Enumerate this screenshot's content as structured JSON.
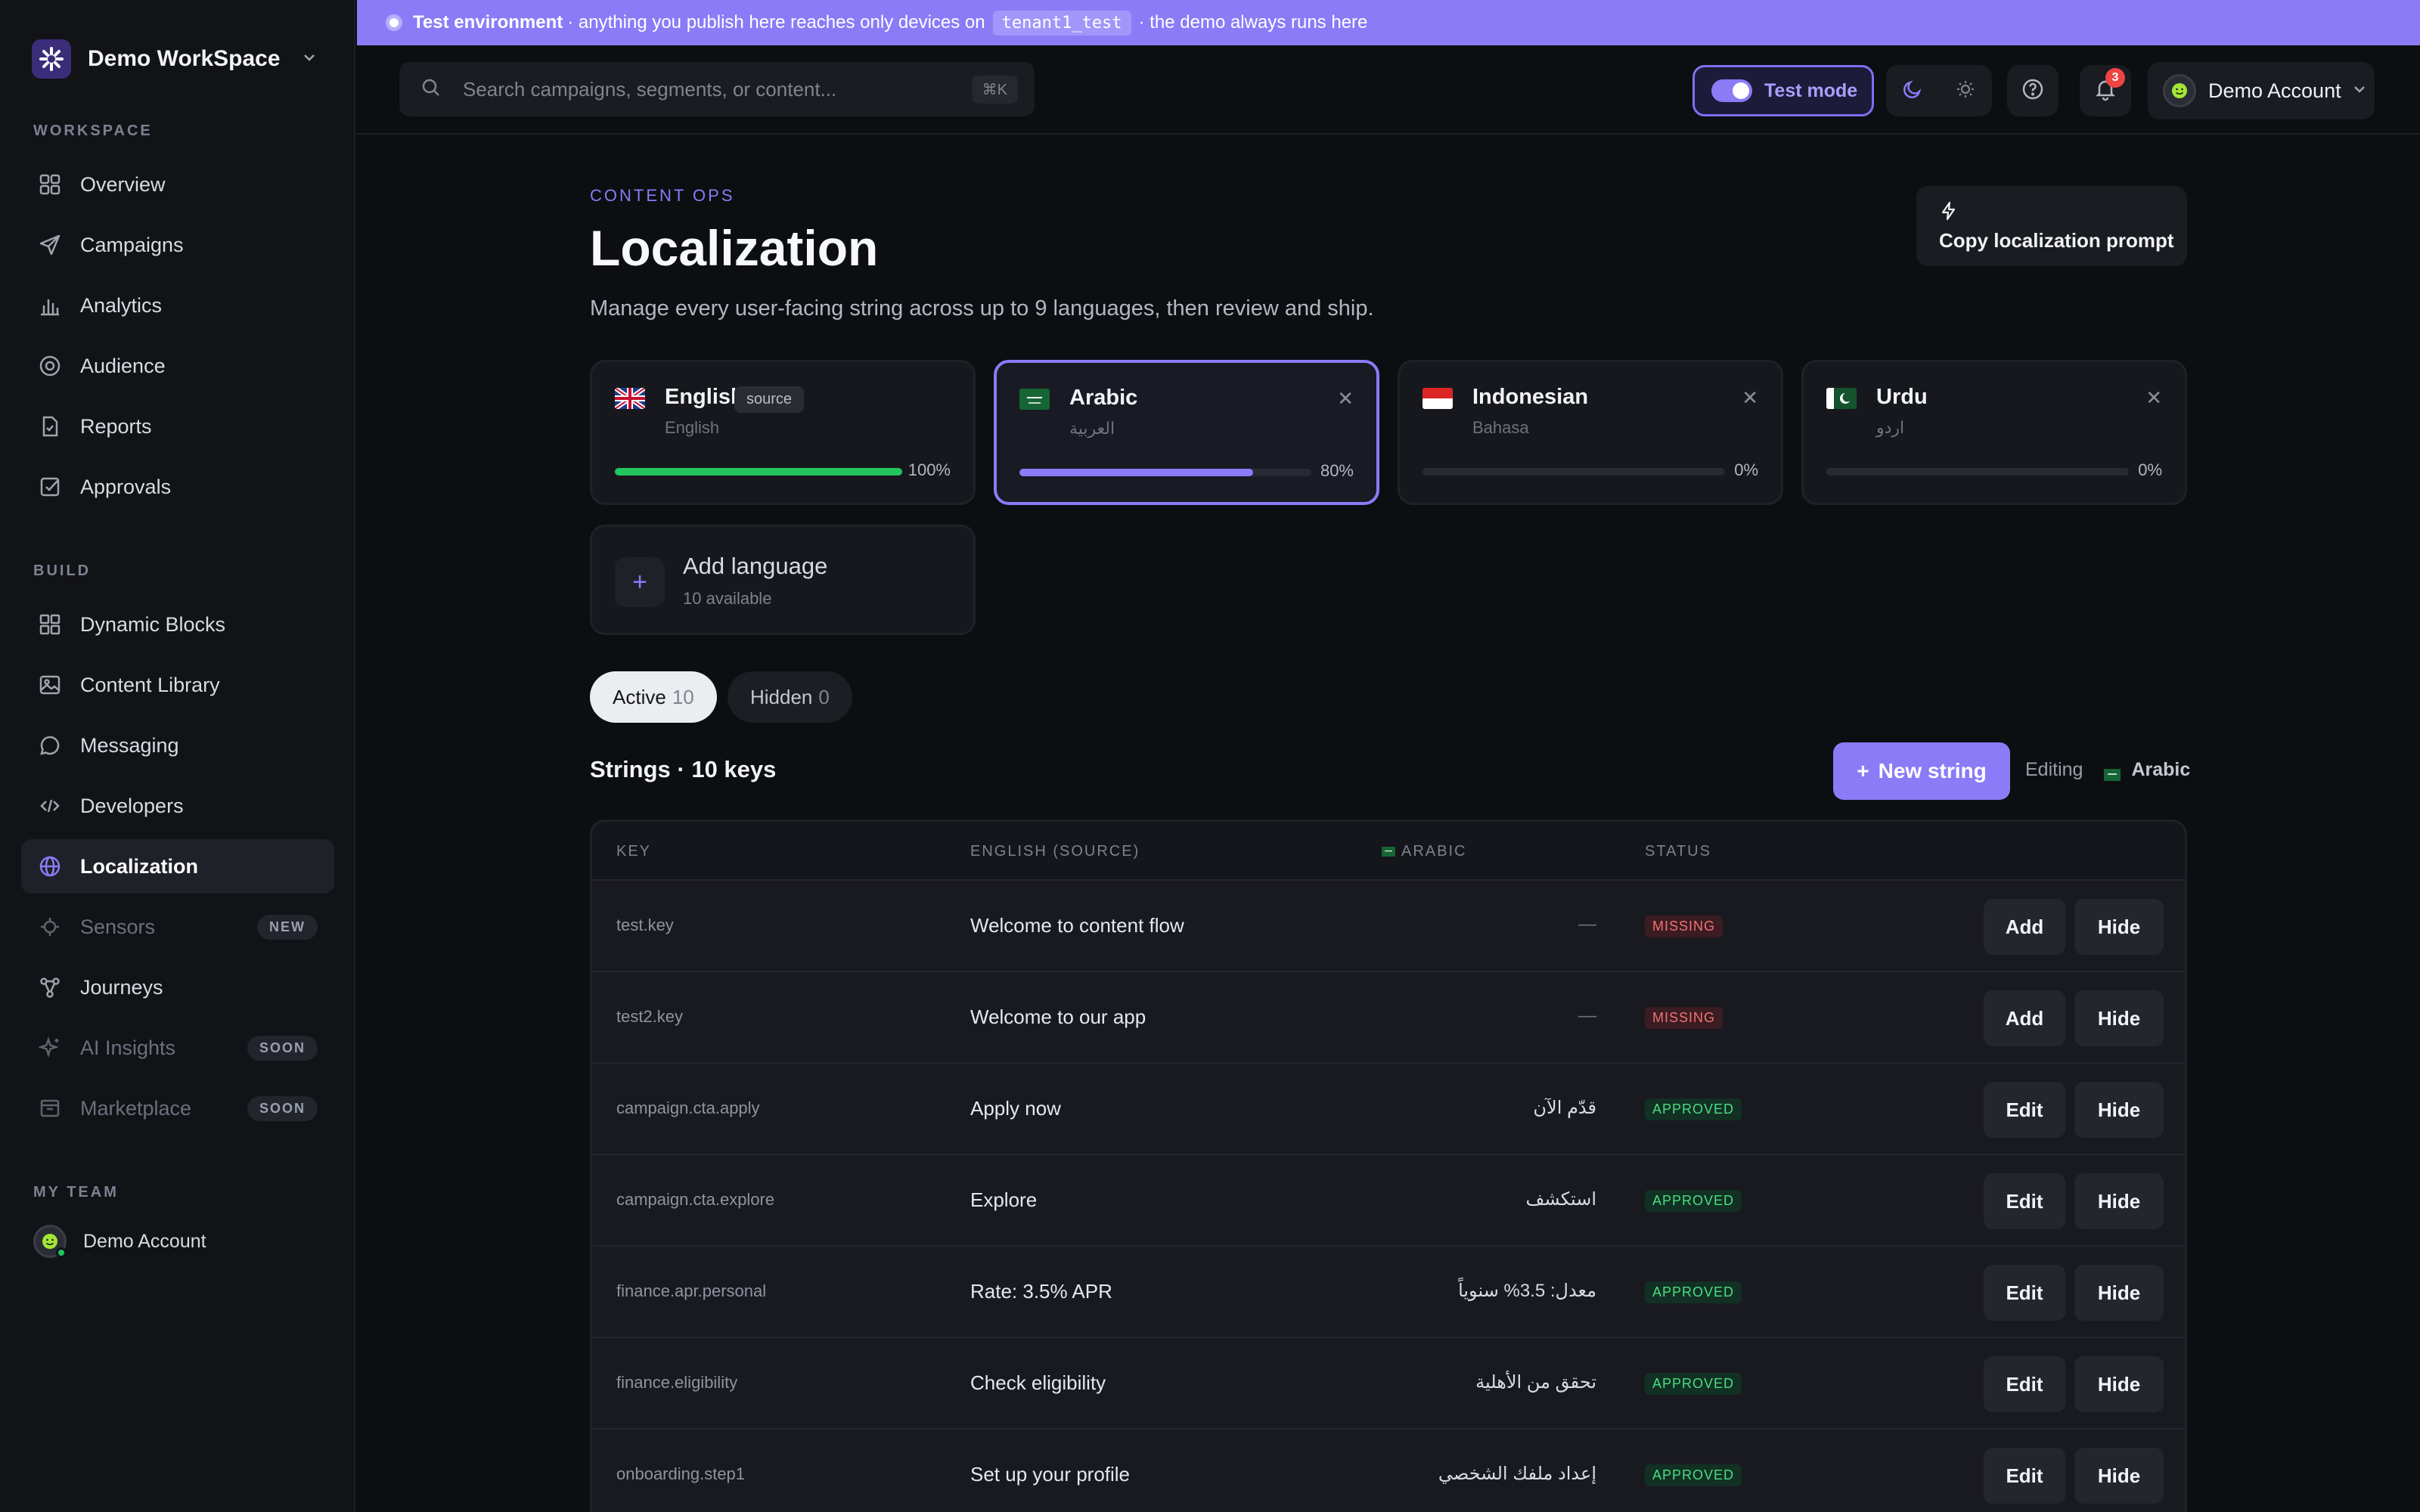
{
  "workspace": {
    "name": "Demo WorkSpace"
  },
  "sidebar": {
    "sections": [
      {
        "label": "WORKSPACE"
      },
      {
        "label": "BUILD"
      },
      {
        "label": "MY TEAM"
      }
    ],
    "items": [
      {
        "label": "Overview",
        "icon": "grid-icon"
      },
      {
        "label": "Campaigns",
        "icon": "send-icon"
      },
      {
        "label": "Analytics",
        "icon": "bar-chart-icon"
      },
      {
        "label": "Audience",
        "icon": "target-icon"
      },
      {
        "label": "Reports",
        "icon": "file-icon"
      },
      {
        "label": "Approvals",
        "icon": "check-square-icon"
      },
      {
        "label": "Dynamic Blocks",
        "icon": "blocks-icon"
      },
      {
        "label": "Content Library",
        "icon": "image-icon"
      },
      {
        "label": "Messaging",
        "icon": "chat-icon"
      },
      {
        "label": "Developers",
        "icon": "code-icon"
      },
      {
        "label": "Localization",
        "icon": "globe-icon",
        "active": true
      },
      {
        "label": "Sensors",
        "icon": "sensor-icon",
        "badge": "NEW"
      },
      {
        "label": "Journeys",
        "icon": "journey-icon"
      },
      {
        "label": "AI Insights",
        "icon": "sparkle-icon",
        "badge": "SOON"
      },
      {
        "label": "Marketplace",
        "icon": "store-icon",
        "badge": "SOON"
      }
    ],
    "team_member": "Demo Account"
  },
  "banner": {
    "title": "Test environment",
    "text_before": " · anything you publish here reaches only devices on",
    "tenant": "tenant1_test",
    "text_after": "· the demo always runs here"
  },
  "topbar": {
    "search_placeholder": "Search campaigns, segments, or content...",
    "shortcut": "⌘K",
    "test_mode_label": "Test mode",
    "notifications_count": "3",
    "account_name": "Demo Account"
  },
  "page": {
    "eyebrow": "CONTENT OPS",
    "title": "Localization",
    "subtitle": "Manage every user-facing string across up to 9 languages, then review and ship.",
    "copy_prompt_label": "Copy localization prompt"
  },
  "languages": [
    {
      "name": "English",
      "native": "English",
      "badge": "source",
      "progress_label": "100%",
      "progress": 1.0,
      "color": "#22c55e"
    },
    {
      "name": "Arabic",
      "native": "العربية",
      "progress_label": "80%",
      "progress": 0.8,
      "color": "#8b7bf7",
      "selected": true
    },
    {
      "name": "Indonesian",
      "native": "Bahasa",
      "progress_label": "0%",
      "progress": 0.0,
      "color": "#8b7bf7"
    },
    {
      "name": "Urdu",
      "native": "اردو",
      "progress_label": "0%",
      "progress": 0.0,
      "color": "#8b7bf7"
    }
  ],
  "add_language": {
    "label": "Add language",
    "sub": "10 available"
  },
  "filters": {
    "active_label": "Active",
    "active_count": "10",
    "hidden_label": "Hidden",
    "hidden_count": "0"
  },
  "strings": {
    "title": "Strings · 10 keys",
    "new_label": "New string",
    "editing_label": "Editing",
    "editing_lang": "Arabic",
    "columns": {
      "key": "KEY",
      "source": "ENGLISH (SOURCE)",
      "target": "ARABIC",
      "status": "STATUS"
    },
    "rows": [
      {
        "key": "test.key",
        "en": "Welcome to content flow",
        "ar": "—",
        "status": "MISSING",
        "action": "Add",
        "hide": "Hide"
      },
      {
        "key": "test2.key",
        "en": "Welcome to our app",
        "ar": "—",
        "status": "MISSING",
        "action": "Add",
        "hide": "Hide"
      },
      {
        "key": "campaign.cta.apply",
        "en": "Apply now",
        "ar": "قدّم الآن",
        "status": "APPROVED",
        "action": "Edit",
        "hide": "Hide"
      },
      {
        "key": "campaign.cta.explore",
        "en": "Explore",
        "ar": "استكشف",
        "status": "APPROVED",
        "action": "Edit",
        "hide": "Hide"
      },
      {
        "key": "finance.apr.personal",
        "en": "Rate: 3.5% APR",
        "ar": "معدل: 3.5% سنوياً",
        "status": "APPROVED",
        "action": "Edit",
        "hide": "Hide"
      },
      {
        "key": "finance.eligibility",
        "en": "Check eligibility",
        "ar": "تحقق من الأهلية",
        "status": "APPROVED",
        "action": "Edit",
        "hide": "Hide"
      },
      {
        "key": "onboarding.step1",
        "en": "Set up your profile",
        "ar": "إعداد ملفك الشخصي",
        "status": "APPROVED",
        "action": "Edit",
        "hide": "Hide"
      }
    ]
  }
}
